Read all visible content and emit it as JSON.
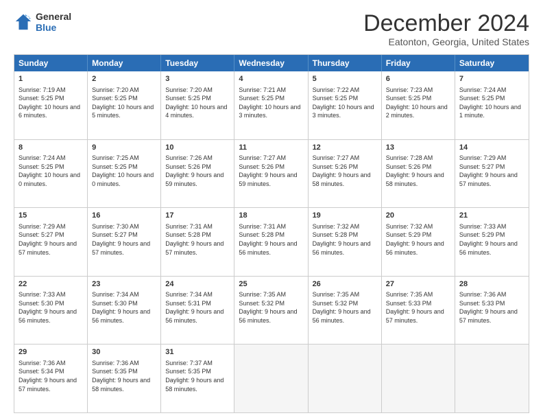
{
  "logo": {
    "line1": "General",
    "line2": "Blue"
  },
  "title": "December 2024",
  "subtitle": "Eatonton, Georgia, United States",
  "header_days": [
    "Sunday",
    "Monday",
    "Tuesday",
    "Wednesday",
    "Thursday",
    "Friday",
    "Saturday"
  ],
  "weeks": [
    [
      {
        "day": "1",
        "sunrise": "Sunrise: 7:19 AM",
        "sunset": "Sunset: 5:25 PM",
        "daylight": "Daylight: 10 hours and 6 minutes."
      },
      {
        "day": "2",
        "sunrise": "Sunrise: 7:20 AM",
        "sunset": "Sunset: 5:25 PM",
        "daylight": "Daylight: 10 hours and 5 minutes."
      },
      {
        "day": "3",
        "sunrise": "Sunrise: 7:20 AM",
        "sunset": "Sunset: 5:25 PM",
        "daylight": "Daylight: 10 hours and 4 minutes."
      },
      {
        "day": "4",
        "sunrise": "Sunrise: 7:21 AM",
        "sunset": "Sunset: 5:25 PM",
        "daylight": "Daylight: 10 hours and 3 minutes."
      },
      {
        "day": "5",
        "sunrise": "Sunrise: 7:22 AM",
        "sunset": "Sunset: 5:25 PM",
        "daylight": "Daylight: 10 hours and 3 minutes."
      },
      {
        "day": "6",
        "sunrise": "Sunrise: 7:23 AM",
        "sunset": "Sunset: 5:25 PM",
        "daylight": "Daylight: 10 hours and 2 minutes."
      },
      {
        "day": "7",
        "sunrise": "Sunrise: 7:24 AM",
        "sunset": "Sunset: 5:25 PM",
        "daylight": "Daylight: 10 hours and 1 minute."
      }
    ],
    [
      {
        "day": "8",
        "sunrise": "Sunrise: 7:24 AM",
        "sunset": "Sunset: 5:25 PM",
        "daylight": "Daylight: 10 hours and 0 minutes."
      },
      {
        "day": "9",
        "sunrise": "Sunrise: 7:25 AM",
        "sunset": "Sunset: 5:25 PM",
        "daylight": "Daylight: 10 hours and 0 minutes."
      },
      {
        "day": "10",
        "sunrise": "Sunrise: 7:26 AM",
        "sunset": "Sunset: 5:26 PM",
        "daylight": "Daylight: 9 hours and 59 minutes."
      },
      {
        "day": "11",
        "sunrise": "Sunrise: 7:27 AM",
        "sunset": "Sunset: 5:26 PM",
        "daylight": "Daylight: 9 hours and 59 minutes."
      },
      {
        "day": "12",
        "sunrise": "Sunrise: 7:27 AM",
        "sunset": "Sunset: 5:26 PM",
        "daylight": "Daylight: 9 hours and 58 minutes."
      },
      {
        "day": "13",
        "sunrise": "Sunrise: 7:28 AM",
        "sunset": "Sunset: 5:26 PM",
        "daylight": "Daylight: 9 hours and 58 minutes."
      },
      {
        "day": "14",
        "sunrise": "Sunrise: 7:29 AM",
        "sunset": "Sunset: 5:27 PM",
        "daylight": "Daylight: 9 hours and 57 minutes."
      }
    ],
    [
      {
        "day": "15",
        "sunrise": "Sunrise: 7:29 AM",
        "sunset": "Sunset: 5:27 PM",
        "daylight": "Daylight: 9 hours and 57 minutes."
      },
      {
        "day": "16",
        "sunrise": "Sunrise: 7:30 AM",
        "sunset": "Sunset: 5:27 PM",
        "daylight": "Daylight: 9 hours and 57 minutes."
      },
      {
        "day": "17",
        "sunrise": "Sunrise: 7:31 AM",
        "sunset": "Sunset: 5:28 PM",
        "daylight": "Daylight: 9 hours and 57 minutes."
      },
      {
        "day": "18",
        "sunrise": "Sunrise: 7:31 AM",
        "sunset": "Sunset: 5:28 PM",
        "daylight": "Daylight: 9 hours and 56 minutes."
      },
      {
        "day": "19",
        "sunrise": "Sunrise: 7:32 AM",
        "sunset": "Sunset: 5:28 PM",
        "daylight": "Daylight: 9 hours and 56 minutes."
      },
      {
        "day": "20",
        "sunrise": "Sunrise: 7:32 AM",
        "sunset": "Sunset: 5:29 PM",
        "daylight": "Daylight: 9 hours and 56 minutes."
      },
      {
        "day": "21",
        "sunrise": "Sunrise: 7:33 AM",
        "sunset": "Sunset: 5:29 PM",
        "daylight": "Daylight: 9 hours and 56 minutes."
      }
    ],
    [
      {
        "day": "22",
        "sunrise": "Sunrise: 7:33 AM",
        "sunset": "Sunset: 5:30 PM",
        "daylight": "Daylight: 9 hours and 56 minutes."
      },
      {
        "day": "23",
        "sunrise": "Sunrise: 7:34 AM",
        "sunset": "Sunset: 5:30 PM",
        "daylight": "Daylight: 9 hours and 56 minutes."
      },
      {
        "day": "24",
        "sunrise": "Sunrise: 7:34 AM",
        "sunset": "Sunset: 5:31 PM",
        "daylight": "Daylight: 9 hours and 56 minutes."
      },
      {
        "day": "25",
        "sunrise": "Sunrise: 7:35 AM",
        "sunset": "Sunset: 5:32 PM",
        "daylight": "Daylight: 9 hours and 56 minutes."
      },
      {
        "day": "26",
        "sunrise": "Sunrise: 7:35 AM",
        "sunset": "Sunset: 5:32 PM",
        "daylight": "Daylight: 9 hours and 56 minutes."
      },
      {
        "day": "27",
        "sunrise": "Sunrise: 7:35 AM",
        "sunset": "Sunset: 5:33 PM",
        "daylight": "Daylight: 9 hours and 57 minutes."
      },
      {
        "day": "28",
        "sunrise": "Sunrise: 7:36 AM",
        "sunset": "Sunset: 5:33 PM",
        "daylight": "Daylight: 9 hours and 57 minutes."
      }
    ],
    [
      {
        "day": "29",
        "sunrise": "Sunrise: 7:36 AM",
        "sunset": "Sunset: 5:34 PM",
        "daylight": "Daylight: 9 hours and 57 minutes."
      },
      {
        "day": "30",
        "sunrise": "Sunrise: 7:36 AM",
        "sunset": "Sunset: 5:35 PM",
        "daylight": "Daylight: 9 hours and 58 minutes."
      },
      {
        "day": "31",
        "sunrise": "Sunrise: 7:37 AM",
        "sunset": "Sunset: 5:35 PM",
        "daylight": "Daylight: 9 hours and 58 minutes."
      },
      null,
      null,
      null,
      null
    ]
  ]
}
